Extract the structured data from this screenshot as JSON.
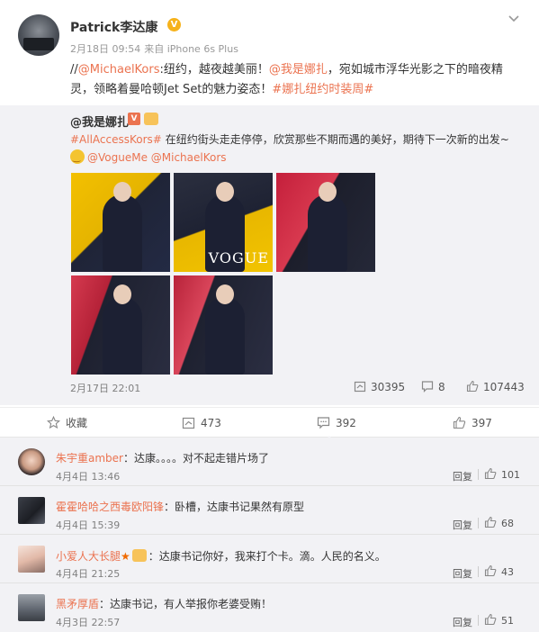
{
  "post": {
    "username": "Patrick李达康",
    "date": "2月18日 09:54",
    "source": "来自 iPhone 6s Plus",
    "content": {
      "prefix": "//",
      "mention1": "@MichaelKors",
      "text1": ":纽约，越夜越美丽！",
      "mention2": "@我是娜扎",
      "text2": "，宛如城市浮华光影之下的暗夜精灵，领略着曼哈顿Jet Set的魅力姿态！",
      "hashtag": "#娜扎纽约时装周#"
    }
  },
  "repost": {
    "username": "@我是娜扎",
    "hashtag": "#AllAccessKors#",
    "text": " 在纽约街头走走停停，欣赏那些不期而遇的美好，期待下一次新的出发~",
    "mentions": "@VogueMe @MichaelKors",
    "photo_caption": "VOGUE",
    "time": "2月17日 22:01",
    "reposts": "30395",
    "comments": "8",
    "likes": "107443"
  },
  "actions": {
    "favorite_label": "收藏",
    "repost_count": "473",
    "comment_count": "392",
    "like_count": "397"
  },
  "comments": [
    {
      "user": "朱宇重amber",
      "text": "：达康。。。。对不起走错片场了",
      "time": "4月4日 13:46",
      "reply": "回复",
      "likes": "101"
    },
    {
      "user": "霍霍哈哈之西毒欧阳锋",
      "text": "：卧槽，达康书记果然有原型",
      "time": "4月4日 15:39",
      "reply": "回复",
      "likes": "68"
    },
    {
      "user": "小爱人大长腿",
      "text": "：达康书记你好，我来打个卡。滴。人民的名义。",
      "time": "4月4日 21:25",
      "reply": "回复",
      "likes": "43"
    },
    {
      "user": "黑矛厚盾",
      "text": "：达康书记，有人举报你老婆受贿！",
      "time": "4月3日 22:57",
      "reply": "回复",
      "likes": "51"
    }
  ],
  "colors": {
    "link": "#eb7350",
    "verified_badge": "#f6b21b",
    "repost_bg": "#f2f2f5"
  },
  "icons": {
    "chevron": "chevron-down-icon",
    "verified": "verified-badge-icon",
    "star": "star-icon",
    "repost": "repost-icon",
    "comment": "comment-icon",
    "like": "like-icon",
    "favorite": "favorite-icon"
  }
}
